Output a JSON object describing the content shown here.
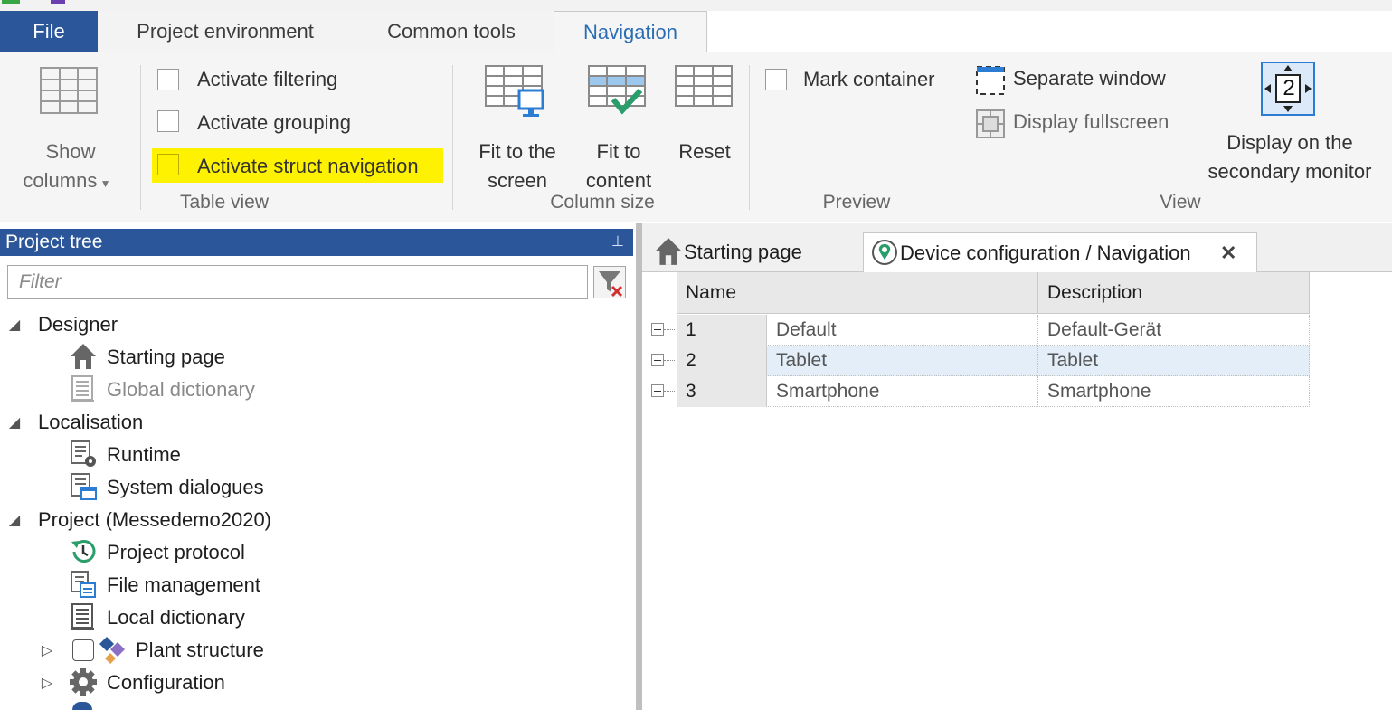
{
  "tabs": {
    "file": "File",
    "project_environment": "Project environment",
    "common_tools": "Common tools",
    "navigation": "Navigation"
  },
  "ribbon": {
    "show_columns_line1": "Show",
    "show_columns_line2": "columns",
    "activate_filtering": "Activate filtering",
    "activate_grouping": "Activate grouping",
    "activate_struct_navigation": "Activate struct navigation",
    "table_view_label": "Table view",
    "fit_to_screen_line1": "Fit to the",
    "fit_to_screen_line2": "screen",
    "fit_to_content_line1": "Fit to",
    "fit_to_content_line2": "content",
    "reset": "Reset",
    "column_size_label": "Column size",
    "mark_container": "Mark container",
    "preview_label": "Preview",
    "separate_window": "Separate window",
    "display_fullscreen": "Display fullscreen",
    "secondary_monitor_line1": "Display on the",
    "secondary_monitor_line2": "secondary monitor",
    "monitor_number": "2",
    "view_label": "View",
    "highlight_color": "#fff200"
  },
  "project_tree": {
    "title": "Project tree",
    "filter_placeholder": "Filter",
    "items": [
      {
        "label": "Designer",
        "icon": "collapse-arrow"
      },
      {
        "label": "Starting page",
        "icon": "home-icon"
      },
      {
        "label": "Global dictionary",
        "icon": "dictionary-icon"
      },
      {
        "label": "Localisation",
        "icon": "collapse-arrow"
      },
      {
        "label": "Runtime",
        "icon": "runtime-settings-icon"
      },
      {
        "label": "System dialogues",
        "icon": "dialogue-icon"
      },
      {
        "label": "Project (Messedemo2020)",
        "icon": "collapse-arrow"
      },
      {
        "label": "Project protocol",
        "icon": "history-icon"
      },
      {
        "label": "File management",
        "icon": "file-management-icon"
      },
      {
        "label": "Local dictionary",
        "icon": "dictionary-icon"
      },
      {
        "label": "Plant structure",
        "icon": "plant-structure-icon"
      },
      {
        "label": "Configuration",
        "icon": "gear-icon"
      }
    ]
  },
  "doc_tabs": {
    "starting_page": "Starting page",
    "device_config": "Device configuration / Navigation",
    "close": "✕"
  },
  "grid": {
    "headers": [
      "Name",
      "Description"
    ],
    "rows": [
      {
        "id": "1",
        "name": "Default",
        "description": "Default-Gerät"
      },
      {
        "id": "2",
        "name": "Tablet",
        "description": "Tablet"
      },
      {
        "id": "3",
        "name": "Smartphone",
        "description": "Smartphone"
      }
    ]
  }
}
